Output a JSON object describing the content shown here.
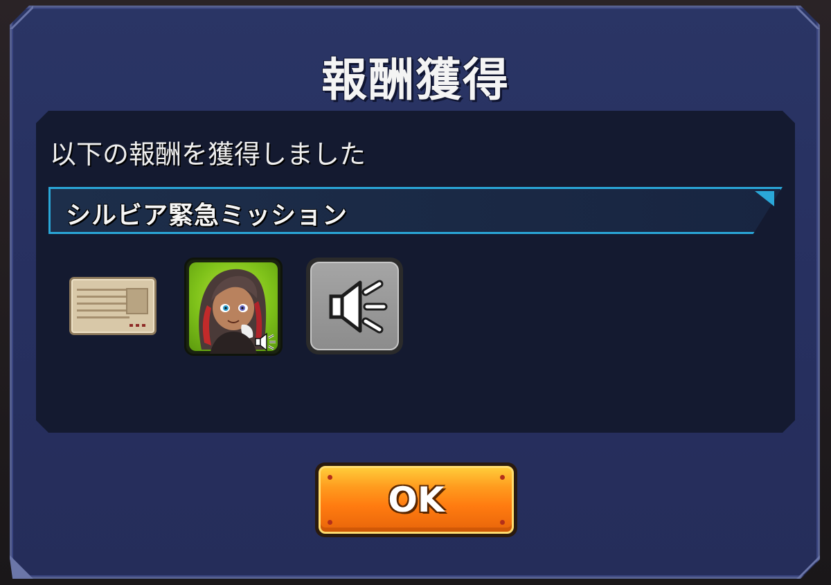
{
  "dialog": {
    "title": "報酬獲得",
    "message": "以下の報酬を獲得しました",
    "mission_name": "シルビア緊急ミッション"
  },
  "rewards": [
    {
      "type": "ticket",
      "icon": "ticket-icon"
    },
    {
      "type": "character",
      "icon": "character-portrait-icon"
    },
    {
      "type": "voice",
      "icon": "speaker-icon"
    }
  ],
  "actions": {
    "ok_label": "OK"
  },
  "colors": {
    "dialog_bg": "#273060",
    "panel_bg": "#141a30",
    "mission_border": "#2aa7d8",
    "ok_button": "#ff7b10",
    "character_frame": "#7fc21a"
  }
}
